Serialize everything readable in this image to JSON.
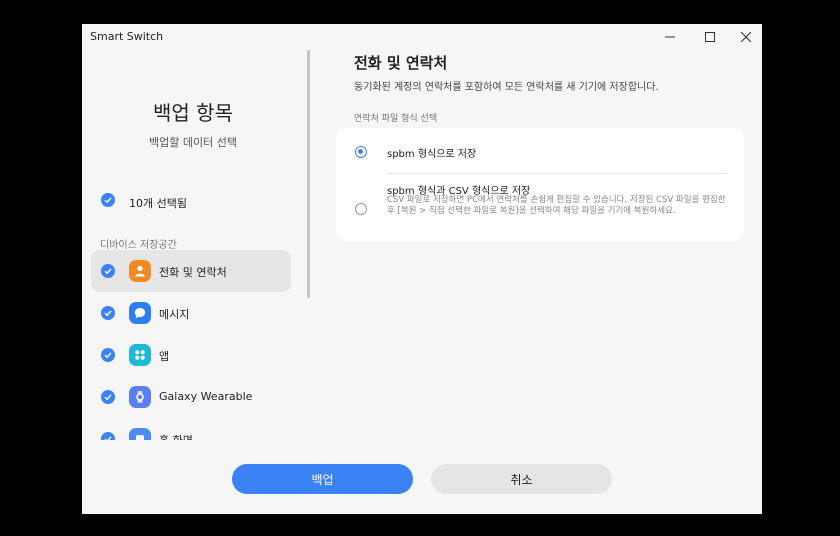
{
  "window": {
    "title": "Smart Switch",
    "controls": {
      "minimize": "—",
      "maximize": "☐",
      "close": "✕"
    }
  },
  "sidebar": {
    "title": "백업 항목",
    "subtitle": "백업할 데이터 선택",
    "selected_count": "10개 선택됨",
    "section_label": "디바이스 저장공간",
    "items": [
      {
        "label": "전화 및 연락처",
        "icon": "contacts-icon",
        "color": "#f08a24",
        "checked": true
      },
      {
        "label": "메시지",
        "icon": "message-icon",
        "color": "#2f7ef0",
        "checked": true
      },
      {
        "label": "앱",
        "icon": "apps-icon",
        "color": "#20b8d4",
        "checked": true
      },
      {
        "label": "Galaxy Wearable",
        "icon": "watch-icon",
        "color": "#5a7ff0",
        "checked": true
      },
      {
        "label": "홈 화면",
        "icon": "home-screen-icon",
        "color": "#4a8df0",
        "checked": true
      }
    ]
  },
  "detail": {
    "title": "전화 및 연락처",
    "description": "동기화된 계정의 연락처를 포함하여 모든 연락처를 새 기기에 저장합니다.",
    "format_label": "연락처 파일 형식 선택",
    "options": [
      {
        "label": "spbm 형식으로 저장",
        "selected": true
      },
      {
        "label": "spbm 형식과 CSV 형식으로 저장",
        "description": "CSV 파일로 저장하면 PC에서 연락처를 손쉽게 편집할 수 있습니다. 저장된 CSV 파일을 편집한 후 [복원 > 직접 선택한 파일로 복원]을 선택하여 해당 파일을 기기에 복원하세요.",
        "selected": false
      }
    ]
  },
  "buttons": {
    "backup": "백업",
    "cancel": "취소"
  },
  "colors": {
    "accent": "#3b82f6"
  }
}
